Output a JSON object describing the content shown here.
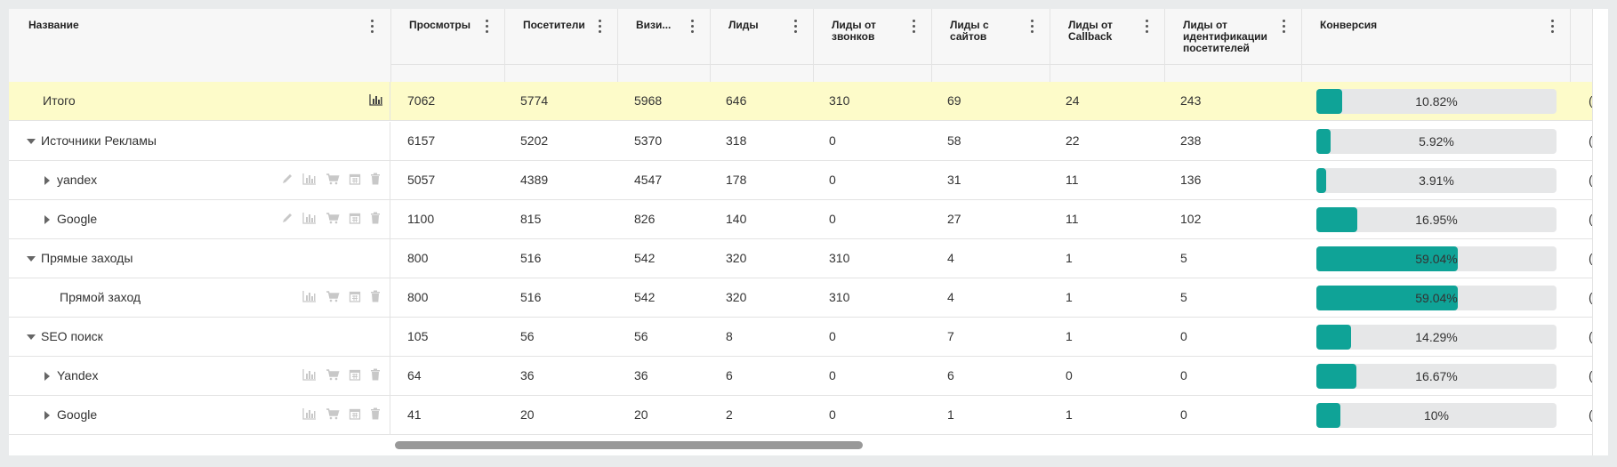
{
  "columns": {
    "name": "Название",
    "views": "Просмотры",
    "visitors": "Посетители",
    "visits": "Визи...",
    "leads": "Лиды",
    "leads_calls": "Лиды от звонков",
    "leads_sites": "Лиды с сайтов",
    "leads_callback": "Лиды от Callback",
    "leads_ident": "Лиды от идентификации посетителей",
    "conversion": "Конверсия"
  },
  "rows": [
    {
      "name": "Итого",
      "views": "7062",
      "visitors": "5774",
      "visits": "5968",
      "leads": "646",
      "calls": "310",
      "sites": "69",
      "callback": "24",
      "ident": "243",
      "conv": "10.82%",
      "conv_value": 10.82,
      "edge": "("
    },
    {
      "name": "Источники Рекламы",
      "views": "6157",
      "visitors": "5202",
      "visits": "5370",
      "leads": "318",
      "calls": "0",
      "sites": "58",
      "callback": "22",
      "ident": "238",
      "conv": "5.92%",
      "conv_value": 5.92,
      "edge": "("
    },
    {
      "name": "yandex",
      "views": "5057",
      "visitors": "4389",
      "visits": "4547",
      "leads": "178",
      "calls": "0",
      "sites": "31",
      "callback": "11",
      "ident": "136",
      "conv": "3.91%",
      "conv_value": 3.91,
      "edge": "("
    },
    {
      "name": "Google",
      "views": "1100",
      "visitors": "815",
      "visits": "826",
      "leads": "140",
      "calls": "0",
      "sites": "27",
      "callback": "11",
      "ident": "102",
      "conv": "16.95%",
      "conv_value": 16.95,
      "edge": "("
    },
    {
      "name": "Прямые заходы",
      "views": "800",
      "visitors": "516",
      "visits": "542",
      "leads": "320",
      "calls": "310",
      "sites": "4",
      "callback": "1",
      "ident": "5",
      "conv": "59.04%",
      "conv_value": 59.04,
      "edge": "("
    },
    {
      "name": "Прямой заход",
      "views": "800",
      "visitors": "516",
      "visits": "542",
      "leads": "320",
      "calls": "310",
      "sites": "4",
      "callback": "1",
      "ident": "5",
      "conv": "59.04%",
      "conv_value": 59.04,
      "edge": "("
    },
    {
      "name": "SEO поиск",
      "views": "105",
      "visitors": "56",
      "visits": "56",
      "leads": "8",
      "calls": "0",
      "sites": "7",
      "callback": "1",
      "ident": "0",
      "conv": "14.29%",
      "conv_value": 14.29,
      "edge": "("
    },
    {
      "name": "Yandex",
      "views": "64",
      "visitors": "36",
      "visits": "36",
      "leads": "6",
      "calls": "0",
      "sites": "6",
      "callback": "0",
      "ident": "0",
      "conv": "16.67%",
      "conv_value": 16.67,
      "edge": "("
    },
    {
      "name": "Google",
      "views": "41",
      "visitors": "20",
      "visits": "20",
      "leads": "2",
      "calls": "0",
      "sites": "1",
      "callback": "1",
      "ident": "0",
      "conv": "10%",
      "conv_value": 10,
      "edge": "("
    }
  ],
  "colors": {
    "accent": "#0fa397",
    "total_bg": "#fdfbc9"
  },
  "icons": [
    "edit-icon",
    "bar-chart-icon",
    "cart-icon",
    "calendar-icon",
    "trash-icon"
  ]
}
